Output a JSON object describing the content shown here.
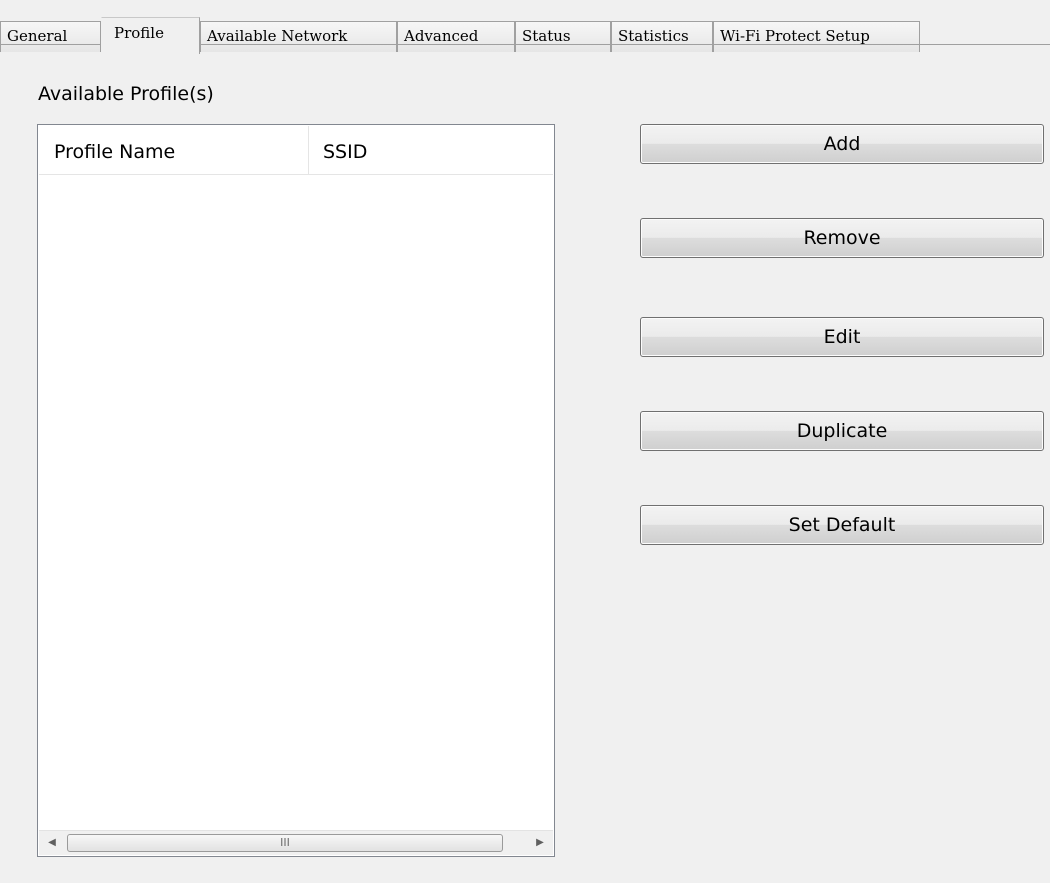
{
  "tabs": [
    {
      "label": "General"
    },
    {
      "label": "Profile",
      "active": true
    },
    {
      "label": "Available Network"
    },
    {
      "label": "Advanced"
    },
    {
      "label": "Status"
    },
    {
      "label": "Statistics"
    },
    {
      "label": "Wi-Fi Protect Setup"
    }
  ],
  "profile": {
    "group_label": "Available Profile(s)",
    "columns": [
      "Profile Name",
      "SSID"
    ],
    "rows": [],
    "scrollbar": {
      "left_arrow": "◀",
      "right_arrow": "▶",
      "thumb_grip": "III"
    }
  },
  "buttons": {
    "add": "Add",
    "remove": "Remove",
    "edit": "Edit",
    "duplicate": "Duplicate",
    "set_default": "Set Default"
  }
}
